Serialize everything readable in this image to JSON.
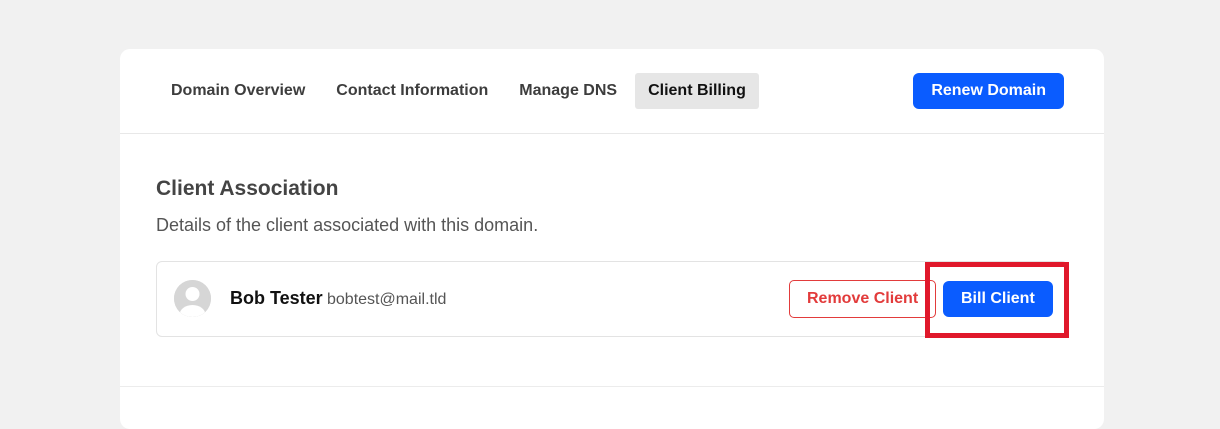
{
  "tabs": [
    {
      "label": "Domain Overview",
      "active": false
    },
    {
      "label": "Contact Information",
      "active": false
    },
    {
      "label": "Manage DNS",
      "active": false
    },
    {
      "label": "Client Billing",
      "active": true
    }
  ],
  "header": {
    "renew_label": "Renew Domain"
  },
  "section": {
    "title": "Client Association",
    "description": "Details of the client associated with this domain."
  },
  "client": {
    "name": "Bob Tester",
    "email": "bobtest@mail.tld",
    "avatar_icon": "user-avatar-icon",
    "remove_label": "Remove Client",
    "bill_label": "Bill Client"
  },
  "colors": {
    "primary": "#0a5cff",
    "danger": "#e23b3b",
    "highlight": "#e0182b"
  }
}
